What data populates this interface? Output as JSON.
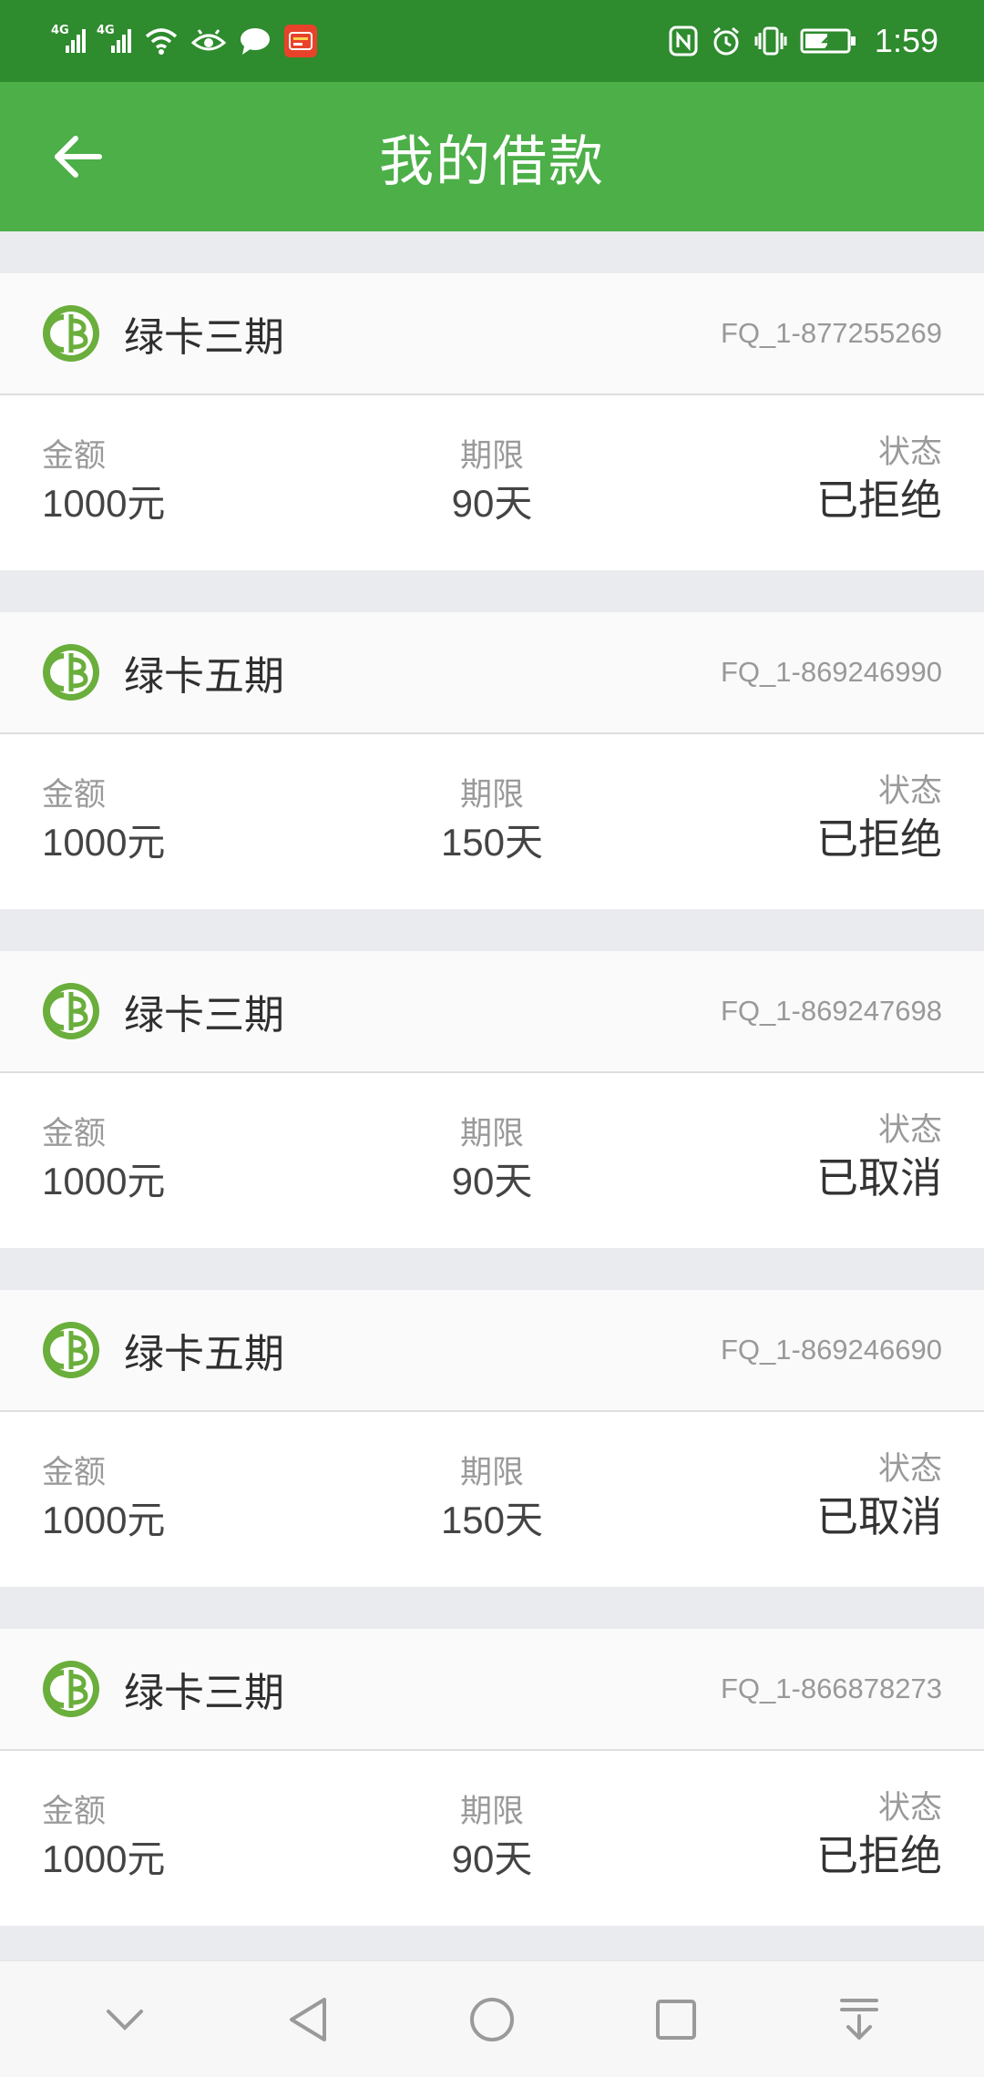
{
  "status_bar": {
    "network_1": "4G",
    "network_2": "4G",
    "time": "1:59"
  },
  "header": {
    "title": "我的借款"
  },
  "labels": {
    "amount": "金额",
    "term": "期限",
    "status": "状态"
  },
  "loans": [
    {
      "product": "绿卡三期",
      "order_no": "FQ_1-877255269",
      "amount": "1000元",
      "term": "90天",
      "status": "已拒绝"
    },
    {
      "product": "绿卡五期",
      "order_no": "FQ_1-869246990",
      "amount": "1000元",
      "term": "150天",
      "status": "已拒绝"
    },
    {
      "product": "绿卡三期",
      "order_no": "FQ_1-869247698",
      "amount": "1000元",
      "term": "90天",
      "status": "已取消"
    },
    {
      "product": "绿卡五期",
      "order_no": "FQ_1-869246690",
      "amount": "1000元",
      "term": "150天",
      "status": "已取消"
    },
    {
      "product": "绿卡三期",
      "order_no": "FQ_1-866878273",
      "amount": "1000元",
      "term": "90天",
      "status": "已拒绝"
    }
  ],
  "colors": {
    "status_bar": "#2e8b2e",
    "title_bar": "#4caf48",
    "logo_green": "#6aae3c"
  },
  "icons": {
    "back": "arrow-left-icon",
    "product_logo": "greencard-logo-icon",
    "nav": [
      "chevron-down-icon",
      "back-triangle-icon",
      "home-circle-icon",
      "recents-square-icon",
      "pull-down-icon"
    ]
  }
}
